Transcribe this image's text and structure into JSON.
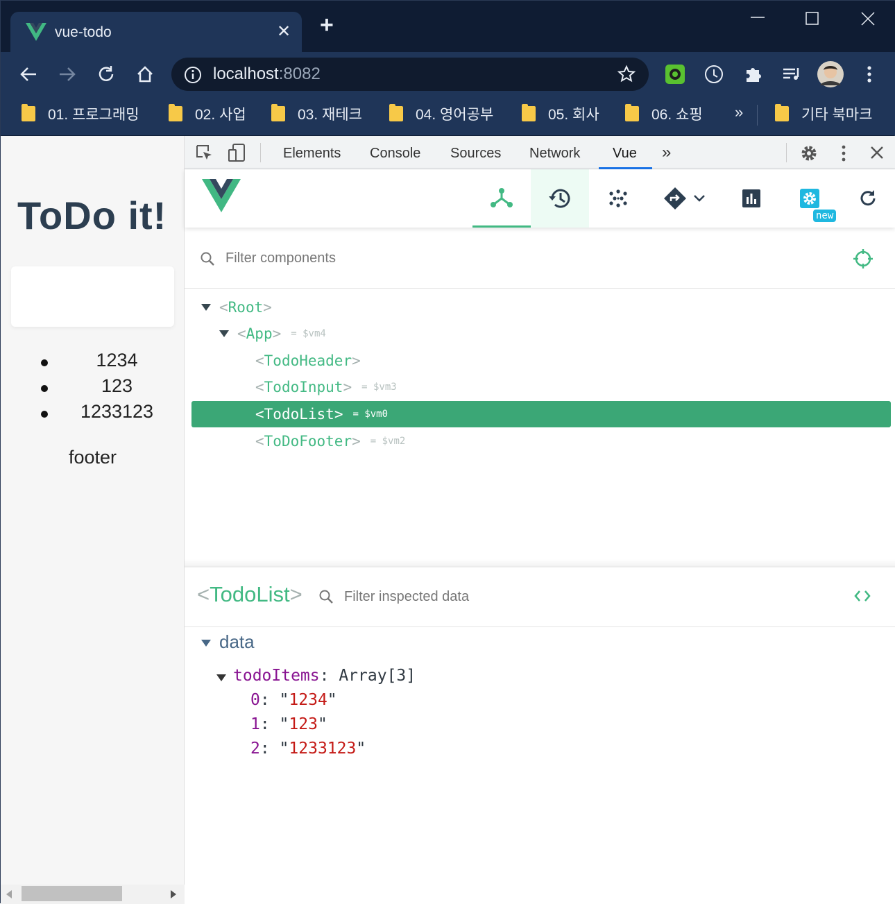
{
  "browser": {
    "tab_title": "vue-todo",
    "url_host": "localhost",
    "url_port": ":8082",
    "bookmarks": [
      "01. 프로그래밍",
      "02. 사업",
      "03. 재테크",
      "04. 영어공부",
      "05. 회사",
      "06. 쇼핑"
    ],
    "bookmarks_overflow": "»",
    "other_bookmarks": "기타 북마크"
  },
  "page": {
    "heading": "ToDo it!",
    "todos": [
      "1234",
      "123",
      "1233123"
    ],
    "footer": "footer"
  },
  "devtools": {
    "tabs": [
      "Elements",
      "Console",
      "Sources",
      "Network",
      "Vue"
    ],
    "active_tab": "Vue",
    "vue": {
      "new_badge": "new",
      "filter_components_placeholder": "Filter components",
      "tree": [
        {
          "name": "Root",
          "vm": "",
          "selected": false
        },
        {
          "name": "App",
          "vm": "= $vm4",
          "selected": false
        },
        {
          "name": "TodoHeader",
          "vm": "",
          "selected": false
        },
        {
          "name": "TodoInput",
          "vm": "= $vm3",
          "selected": false
        },
        {
          "name": "TodoList",
          "vm": "= $vm0",
          "selected": true
        },
        {
          "name": "ToDoFooter",
          "vm": "= $vm2",
          "selected": false
        }
      ],
      "inspected_component": "TodoList",
      "filter_inspected_placeholder": "Filter inspected data",
      "data_section": "data",
      "data_key": "todoItems",
      "data_type": "Array[3]",
      "data_items": [
        {
          "index": "0",
          "value": "1234"
        },
        {
          "index": "1",
          "value": "123"
        },
        {
          "index": "2",
          "value": "1233123"
        }
      ]
    }
  },
  "colors": {
    "vue_green": "#42b983",
    "selected_row": "#3ba776",
    "browser_frame": "#1f3558",
    "heading": "#2c3e50"
  }
}
